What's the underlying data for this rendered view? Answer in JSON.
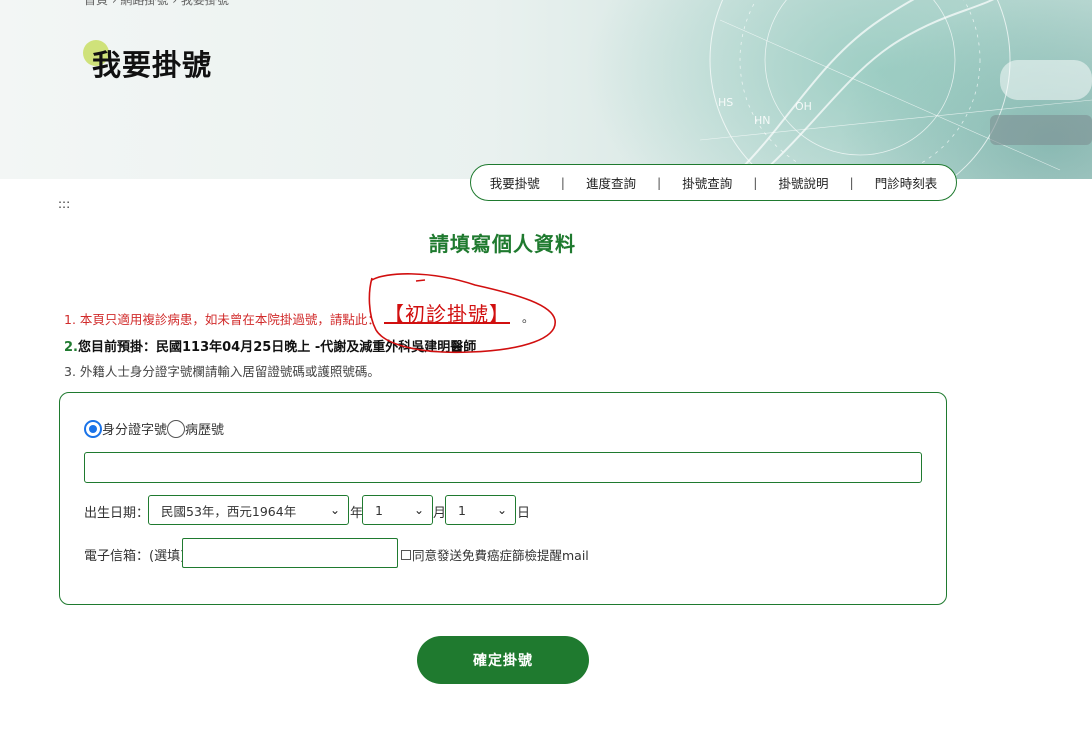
{
  "breadcrumb": "首頁 › 網路掛號 › 我要掛號",
  "page_title": "我要掛號",
  "tabs": [
    {
      "label": "我要掛號"
    },
    {
      "label": "進度查詢"
    },
    {
      "label": "掛號查詢"
    },
    {
      "label": "掛號說明"
    },
    {
      "label": "門診時刻表"
    }
  ],
  "tab_separator": "|",
  "accesskey_marker": ":::",
  "form_title": "請填寫個人資料",
  "notices": {
    "n1_text": "1. 本頁只適用複診病患，如未曾在本院掛過號，請點此：",
    "n1_link": "【初診掛號】",
    "n1_end": "。",
    "n2_num": "2.",
    "n2_text": "您目前預掛：民國113年04月25日晚上 -代謝及減重外科吳建明醫師",
    "n3_text": "3. 外籍人士身分證字號欄請輸入居留證號碼或護照號碼。"
  },
  "form": {
    "radio_id_label": "身分證字號",
    "radio_chart_label": "病歷號",
    "id_value": "",
    "dob_label": "出生日期：",
    "year_selected": "民國53年，西元1964年",
    "year_unit": "年",
    "month_selected": "1",
    "month_unit": "月",
    "day_selected": "1",
    "day_unit": "日",
    "email_label": "電子信箱：(選填)",
    "email_value": "",
    "mail_consent_label": "同意發送免費癌症篩檢提醒mail"
  },
  "submit_label": "確定掛號",
  "colors": {
    "brand_green": "#1f7a2f",
    "notice_red": "#d12b2b",
    "radio_blue": "#1a73e8",
    "annotation_red": "#d10f0f"
  }
}
